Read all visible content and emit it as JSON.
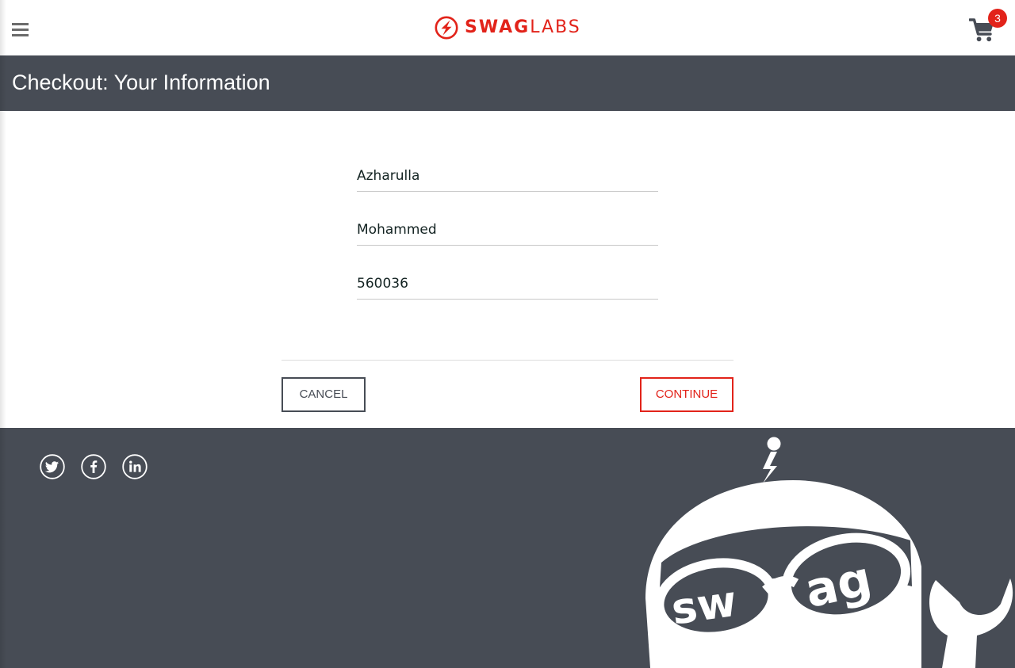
{
  "header": {
    "logo_text_bold": "SWAG",
    "logo_text_light": "LABS",
    "cart_badge": "3",
    "icons": {
      "menu": "hamburger-menu-icon",
      "logo": "swag-labs-bolt-logo-icon",
      "cart": "shopping-cart-icon"
    }
  },
  "subheader": {
    "title": "Checkout: Your Information"
  },
  "form": {
    "first_name": {
      "value": "Azharulla"
    },
    "last_name": {
      "value": "Mohammed"
    },
    "postal_code": {
      "value": "560036"
    }
  },
  "actions": {
    "cancel_label": "CANCEL",
    "continue_label": "CONTINUE"
  },
  "footer": {
    "social": [
      {
        "icon": "twitter-icon"
      },
      {
        "icon": "facebook-icon"
      },
      {
        "icon": "linkedin-icon"
      }
    ],
    "mascot": {
      "icon": "swag-bot-mascot-icon",
      "text_left": "sw",
      "text_right": "ag"
    }
  },
  "colors": {
    "brand_red": "#e2231a",
    "dark_slate": "#474c55",
    "menu_grey": "#6b6b6b",
    "text": "#132322"
  }
}
